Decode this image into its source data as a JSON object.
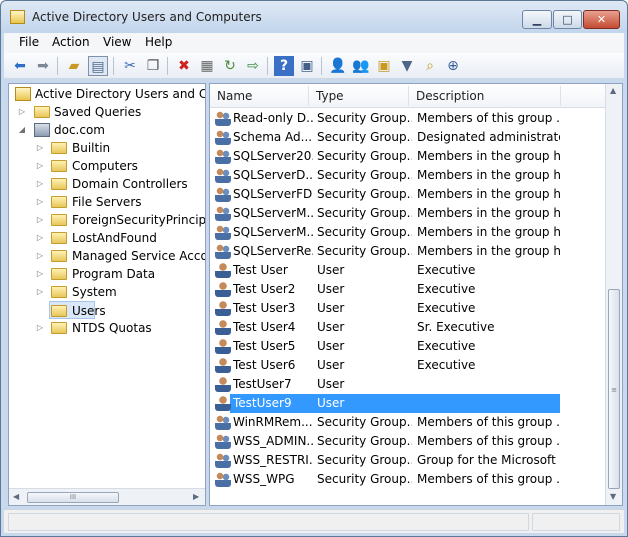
{
  "window": {
    "title": "Active Directory Users and Computers"
  },
  "menu": [
    "File",
    "Action",
    "View",
    "Help"
  ],
  "toolbar_icons": [
    "back-arrow-icon",
    "forward-arrow-icon",
    "up-folder-icon",
    "show-console-tree-icon",
    "cut-icon",
    "copy-icon",
    "delete-icon",
    "properties-icon",
    "refresh-icon",
    "export-list-icon",
    "help-icon",
    "show-action-pane-icon",
    "new-user-icon",
    "new-group-icon",
    "new-ou-icon",
    "filter-icon",
    "find-icon",
    "add-to-group-icon"
  ],
  "tree": {
    "root": "Active Directory Users and Com",
    "saved_queries": "Saved Queries",
    "domain": "doc.com",
    "children": [
      "Builtin",
      "Computers",
      "Domain Controllers",
      "File Servers",
      "ForeignSecurityPrincipals",
      "LostAndFound",
      "Managed Service Accoun",
      "Program Data",
      "System",
      "Users",
      "NTDS Quotas"
    ]
  },
  "list": {
    "columns": [
      "Name",
      "Type",
      "Description"
    ],
    "rows": [
      {
        "name": "Read-only D...",
        "type": "Security Group...",
        "desc": "Members of this group ...",
        "icon": "group"
      },
      {
        "name": "Schema Ad...",
        "type": "Security Group...",
        "desc": "Designated administrato...",
        "icon": "group"
      },
      {
        "name": "SQLServer20...",
        "type": "Security Group...",
        "desc": "Members in the group h...",
        "icon": "group"
      },
      {
        "name": "SQLServerD...",
        "type": "Security Group...",
        "desc": "Members in the group h...",
        "icon": "group"
      },
      {
        "name": "SQLServerFD...",
        "type": "Security Group...",
        "desc": "Members in the group h...",
        "icon": "group"
      },
      {
        "name": "SQLServerM...",
        "type": "Security Group...",
        "desc": "Members in the group h...",
        "icon": "group"
      },
      {
        "name": "SQLServerM...",
        "type": "Security Group...",
        "desc": "Members in the group h...",
        "icon": "group"
      },
      {
        "name": "SQLServerRe...",
        "type": "Security Group...",
        "desc": "Members in the group h...",
        "icon": "group"
      },
      {
        "name": "Test User",
        "type": "User",
        "desc": "Executive",
        "icon": "user"
      },
      {
        "name": "Test User2",
        "type": "User",
        "desc": "Executive",
        "icon": "user"
      },
      {
        "name": "Test User3",
        "type": "User",
        "desc": "Executive",
        "icon": "user"
      },
      {
        "name": "Test User4",
        "type": "User",
        "desc": "Sr. Executive",
        "icon": "user"
      },
      {
        "name": "Test User5",
        "type": "User",
        "desc": "Executive",
        "icon": "user"
      },
      {
        "name": "Test User6",
        "type": "User",
        "desc": "Executive",
        "icon": "user"
      },
      {
        "name": "TestUser7",
        "type": "User",
        "desc": "",
        "icon": "user"
      },
      {
        "name": "TestUser9",
        "type": "User",
        "desc": "",
        "icon": "user",
        "selected": true
      },
      {
        "name": "WinRMRem...",
        "type": "Security Group...",
        "desc": "Members of this group ...",
        "icon": "group"
      },
      {
        "name": "WSS_ADMIN...",
        "type": "Security Group...",
        "desc": "Members of this group ...",
        "icon": "group"
      },
      {
        "name": "WSS_RESTRI...",
        "type": "Security Group...",
        "desc": "Group for the Microsoft ...",
        "icon": "group"
      },
      {
        "name": "WSS_WPG",
        "type": "Security Group...",
        "desc": "Members of this group ...",
        "icon": "group"
      }
    ]
  },
  "colors": {
    "selection": "#3399ff",
    "titlebar": "#c9d9ed"
  }
}
